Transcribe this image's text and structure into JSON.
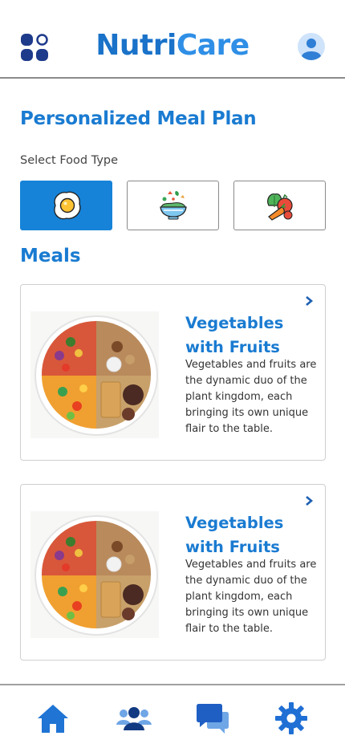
{
  "header": {
    "brand_part1": "Nutri",
    "brand_part2": "Care",
    "menu_icon": "apps-grid-icon",
    "avatar_icon": "user-avatar-icon"
  },
  "main": {
    "title": "Personalized Meal Plan",
    "food_type_label": "Select Food Type",
    "food_types": [
      {
        "icon": "fried-egg-icon",
        "selected": true
      },
      {
        "icon": "salad-bowl-icon",
        "selected": false
      },
      {
        "icon": "vegetables-fruits-icon",
        "selected": false
      }
    ],
    "meals_title": "Meals",
    "meals": [
      {
        "title": "Vegetables with Fruits",
        "description": "Vegetables and fruits are the dynamic duo of the plant kingdom, each bringing its own unique flair to the table."
      },
      {
        "title": "Vegetables with Fruits",
        "description": "Vegetables and fruits are the dynamic duo of the plant kingdom, each bringing its own unique flair to the table."
      }
    ]
  },
  "bottom_nav": [
    {
      "icon": "home-icon",
      "active": true
    },
    {
      "icon": "community-icon",
      "active": false
    },
    {
      "icon": "chat-icon",
      "active": false
    },
    {
      "icon": "settings-gear-icon",
      "active": false
    }
  ],
  "colors": {
    "primary": "#1a7bd1",
    "selected_bg": "#1683d8",
    "dark_navy": "#1e3a8a"
  }
}
